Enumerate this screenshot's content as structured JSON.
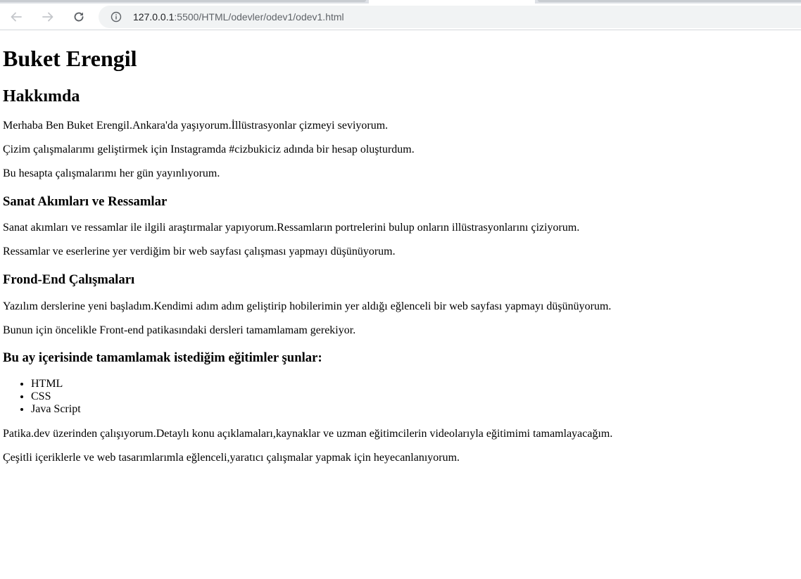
{
  "browser": {
    "url_host": "127.0.0.1",
    "url_path": ":5500/HTML/odevler/odev1/odev1.html",
    "icons": {
      "back": "arrow-left-icon",
      "forward": "arrow-right-icon",
      "reload": "reload-icon",
      "info": "info-icon"
    }
  },
  "page": {
    "title": "Buket Erengil",
    "about_heading": "Hakkımda",
    "about_paragraphs": [
      "Merhaba Ben Buket Erengil.Ankara'da yaşıyorum.İllüstrasyonlar çizmeyi seviyorum.",
      "Çizim çalışmalarımı geliştirmek için Instagramda #cizbukiciz adında bir hesap oluşturdum.",
      "Bu hesapta çalışmalarımı her gün yayınlıyorum."
    ],
    "art_heading": "Sanat Akımları ve Ressamlar",
    "art_paragraphs": [
      "Sanat akımları ve ressamlar ile ilgili araştırmalar yapıyorum.Ressamların portrelerini bulup onların illüstrasyonlarını çiziyorum.",
      "Ressamlar ve eserlerine yer verdiğim bir web sayfası çalışması yapmayı düşünüyorum."
    ],
    "frontend_heading": "Frond-End Çalışmaları",
    "frontend_paragraphs": [
      "Yazılım derslerine yeni başladım.Kendimi adım adım geliştirip hobilerimin yer aldığı eğlenceli bir web sayfası yapmayı düşünüyorum.",
      "Bunun için öncelikle Front-end patikasındaki dersleri tamamlamam gerekiyor."
    ],
    "goals_heading": "Bu ay içerisinde tamamlamak istediğim eğitimler şunlar:",
    "goals_list": [
      "HTML",
      "CSS",
      "Java Script"
    ],
    "closing_paragraphs": [
      "Patika.dev üzerinden çalışıyorum.Detaylı konu açıklamaları,kaynaklar ve uzman eğitimcilerin videolarıyla eğitimimi tamamlayacağım.",
      "Çeşitli içeriklerle ve web tasarımlarımla eğlenceli,yaratıcı çalışmalar yapmak için heyecanlanıyorum."
    ]
  }
}
